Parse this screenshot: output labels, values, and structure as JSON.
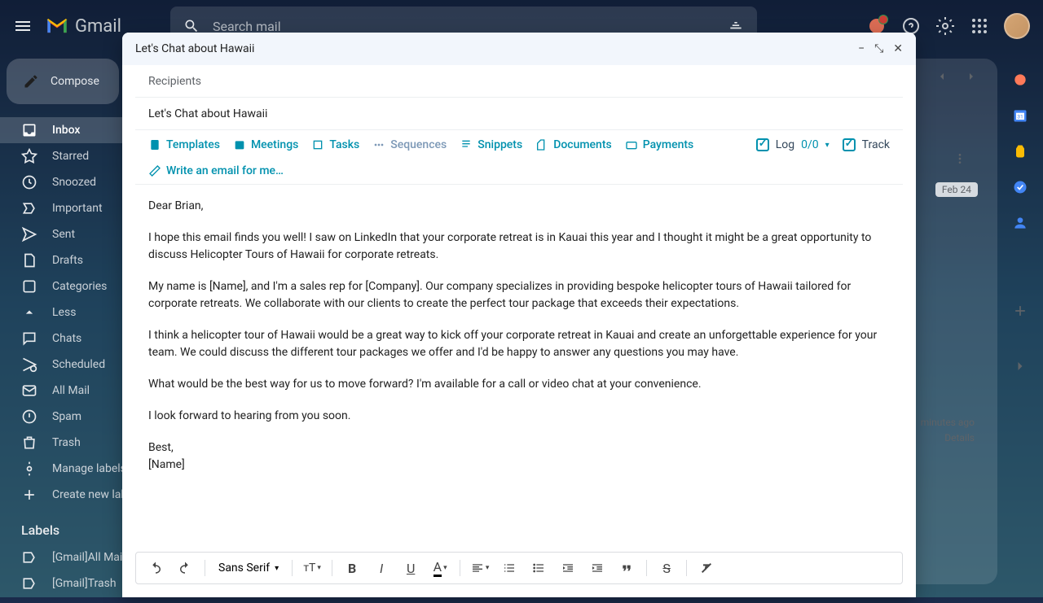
{
  "header": {
    "product": "Gmail",
    "search_placeholder": "Search mail"
  },
  "sidebar": {
    "compose": "Compose",
    "items": [
      {
        "label": "Inbox",
        "icon": "inbox"
      },
      {
        "label": "Starred",
        "icon": "star"
      },
      {
        "label": "Snoozed",
        "icon": "clock"
      },
      {
        "label": "Important",
        "icon": "bookmark"
      },
      {
        "label": "Sent",
        "icon": "send"
      },
      {
        "label": "Drafts",
        "icon": "draft"
      },
      {
        "label": "Categories",
        "icon": "category"
      },
      {
        "label": "Less",
        "icon": "chevron-up"
      },
      {
        "label": "Chats",
        "icon": "chat"
      },
      {
        "label": "Scheduled",
        "icon": "schedule"
      },
      {
        "label": "All Mail",
        "icon": "allmail"
      },
      {
        "label": "Spam",
        "icon": "spam"
      },
      {
        "label": "Trash",
        "icon": "trash"
      },
      {
        "label": "Manage labels",
        "icon": "gear"
      },
      {
        "label": "Create new label",
        "icon": "plus"
      }
    ],
    "labels_header": "Labels",
    "labels": [
      {
        "label": "[Gmail]All Mail"
      },
      {
        "label": "[Gmail]Trash"
      }
    ]
  },
  "mail_bg": {
    "date": "Feb 24",
    "activity_line1": "minutes ago",
    "activity_line2": "Details"
  },
  "compose": {
    "title": "Let's Chat about Hawaii",
    "recipients_placeholder": "Recipients",
    "subject": "Let's Chat about Hawaii",
    "hubspot": {
      "templates": "Templates",
      "meetings": "Meetings",
      "tasks": "Tasks",
      "sequences": "Sequences",
      "snippets": "Snippets",
      "documents": "Documents",
      "payments": "Payments",
      "write_ai": "Write an email for me…",
      "log": "Log",
      "log_count": "0/0",
      "track": "Track"
    },
    "body": {
      "greeting": "Dear Brian,",
      "p1": "I hope this email finds you well! I saw on LinkedIn that your corporate retreat is in Kauai this year and I thought it might be a great opportunity to discuss Helicopter Tours of Hawaii for corporate retreats.",
      "p2": "My name is [Name], and I'm a sales rep for [Company]. Our company specializes in providing bespoke helicopter tours of Hawaii tailored for corporate retreats. We collaborate with our clients to create the perfect tour package that exceeds their expectations.",
      "p3": "I think a helicopter tour of Hawaii would be a great way to kick off your corporate retreat in Kauai and create an unforgettable experience for your team. We could discuss the different tour packages we offer and I'd be happy to answer any questions you may have.",
      "p4": "What would be the best way for us to move forward? I'm available for a call or video chat at your convenience.",
      "p5": "I look forward to hearing from you soon.",
      "closing": "Best,",
      "signature": "[Name]"
    },
    "toolbar": {
      "font": "Sans Serif"
    }
  }
}
